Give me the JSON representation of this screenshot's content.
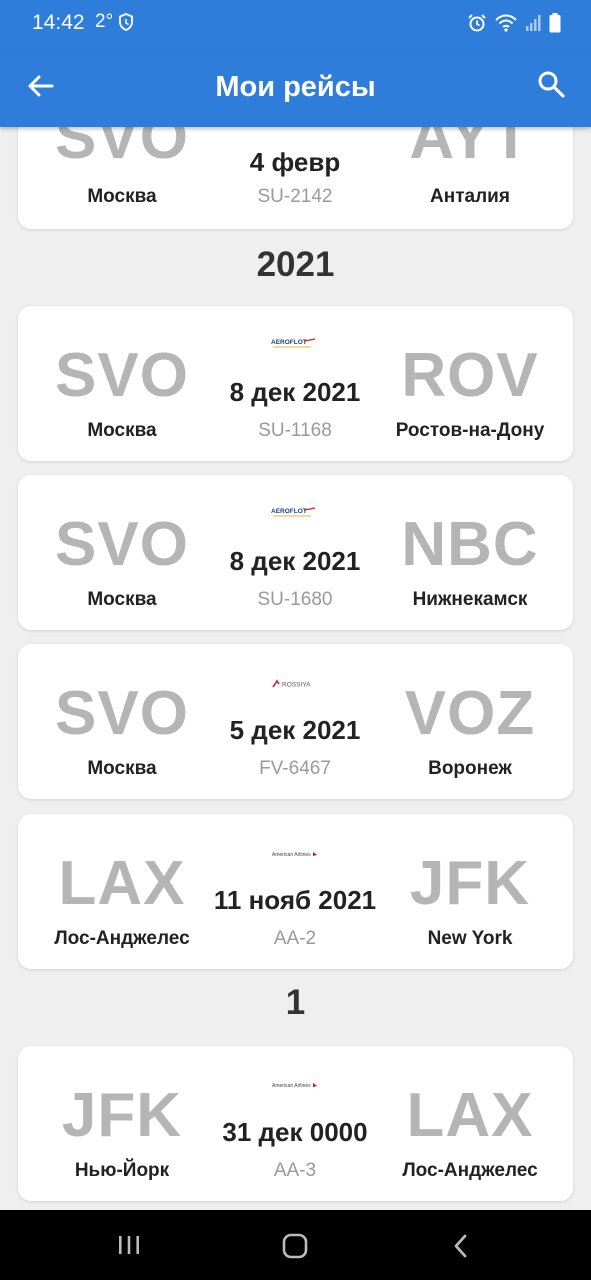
{
  "status": {
    "time": "14:42",
    "temp": "2°"
  },
  "appbar": {
    "title": "Мои рейсы"
  },
  "top_card": {
    "from_code": "SVO",
    "to_code": "AYT",
    "date": "4 февр",
    "flight": "SU-2142",
    "from_city": "Москва",
    "to_city": "Анталия"
  },
  "sections": [
    {
      "label": "2021"
    },
    {
      "label": "1"
    }
  ],
  "flights": [
    {
      "from_code": "SVO",
      "from_city": "Москва",
      "to_code": "ROV",
      "to_city": "Ростов-на-Дону",
      "date": "8 дек 2021",
      "flight": "SU-1168",
      "airline": "aeroflot"
    },
    {
      "from_code": "SVO",
      "from_city": "Москва",
      "to_code": "NBC",
      "to_city": "Нижнекамск",
      "date": "8 дек 2021",
      "flight": "SU-1680",
      "airline": "aeroflot"
    },
    {
      "from_code": "SVO",
      "from_city": "Москва",
      "to_code": "VOZ",
      "to_city": "Воронеж",
      "date": "5 дек 2021",
      "flight": "FV-6467",
      "airline": "rossiya"
    },
    {
      "from_code": "LAX",
      "from_city": "Лос-Анджелес",
      "to_code": "JFK",
      "to_city": "New York",
      "date": "11 нояб 2021",
      "flight": "AA-2",
      "airline": "american-airlines"
    },
    {
      "from_code": "JFK",
      "from_city": "Нью-Йорк",
      "to_code": "LAX",
      "to_city": "Лос-Анджелес",
      "date": "31 дек 0000",
      "flight": "AA-3",
      "airline": "american-airlines"
    }
  ],
  "colors": {
    "accent": "#2f7ddb",
    "code_gray": "#b5b5b5",
    "background": "#efefef"
  },
  "icons": {
    "back": "arrow-left-icon",
    "search": "search-icon"
  }
}
